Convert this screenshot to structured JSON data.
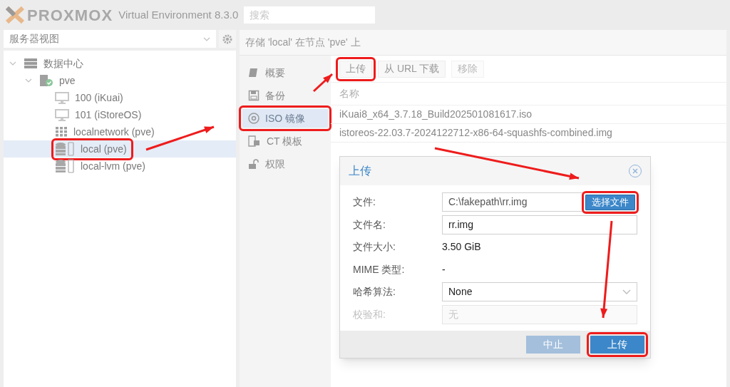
{
  "header": {
    "logo": "PROXMOX",
    "product": "Virtual Environment 8.3.0",
    "search": {
      "placeholder": "搜索"
    }
  },
  "sidebar": {
    "view_select": {
      "value": "服务器视图"
    },
    "tree": [
      {
        "label": "数据中心",
        "kind": "datacenter",
        "expanded": true,
        "selected": false,
        "children": [
          {
            "label": "pve",
            "kind": "node",
            "expanded": true,
            "selected": false,
            "children": [
              {
                "label": "100 (iKuai)",
                "kind": "vm",
                "selected": false
              },
              {
                "label": "101 (iStoreOS)",
                "kind": "vm",
                "selected": false
              },
              {
                "label": "localnetwork (pve)",
                "kind": "network",
                "selected": false
              },
              {
                "label": "local (pve)",
                "kind": "storage",
                "selected": true,
                "annotated": true
              },
              {
                "label": "local-lvm (pve)",
                "kind": "storage",
                "selected": false
              }
            ]
          }
        ]
      }
    ]
  },
  "panel": {
    "title": "存储 'local' 在节点 'pve' 上",
    "nav": [
      {
        "label": "概要",
        "kind": "summary",
        "selected": false
      },
      {
        "label": "备份",
        "kind": "backup",
        "selected": false
      },
      {
        "label": "ISO 镜像",
        "kind": "iso",
        "selected": true,
        "annotated": true
      },
      {
        "label": "CT 模板",
        "kind": "template",
        "selected": false
      },
      {
        "label": "权限",
        "kind": "permissions",
        "selected": false
      }
    ],
    "toolbar": [
      {
        "label": "上传",
        "disabled": false,
        "annotated": true
      },
      {
        "label": "从 URL 下载",
        "disabled": false
      },
      {
        "label": "移除",
        "disabled": true
      }
    ],
    "table": {
      "columns": [
        "名称"
      ],
      "rows": [
        "iKuai8_x64_3.7.18_Build202501081617.iso",
        "istoreos-22.03.7-2024122712-x86-64-squashfs-combined.img"
      ]
    }
  },
  "dialog": {
    "title": "上传",
    "fields": [
      {
        "label": "文件:",
        "kind": "file",
        "value": "C:\\fakepath\\rr.img",
        "button": "选择文件",
        "annotated": true,
        "disabled": false
      },
      {
        "label": "文件名:",
        "kind": "text",
        "value": "rr.img",
        "disabled": false
      },
      {
        "label": "文件大小:",
        "kind": "static",
        "value": "3.50 GiB",
        "disabled": false
      },
      {
        "label": "MIME 类型:",
        "kind": "static",
        "value": "-",
        "disabled": false
      },
      {
        "label": "哈希算法:",
        "kind": "select",
        "value": "None",
        "disabled": false
      },
      {
        "label": "校验和:",
        "kind": "text",
        "placeholder": "无",
        "disabled": true
      }
    ],
    "buttons": [
      {
        "label": "中止",
        "disabled": true
      },
      {
        "label": "上传",
        "disabled": false,
        "annotated": true
      }
    ]
  }
}
